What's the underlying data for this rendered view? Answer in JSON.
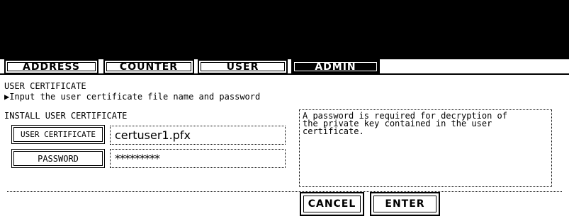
{
  "tabs": [
    {
      "label": "ADDRESS"
    },
    {
      "label": "COUNTER"
    },
    {
      "label": "USER"
    },
    {
      "label": "ADMIN"
    }
  ],
  "screen": {
    "title": "USER CERTIFICATE",
    "instruction": "▶Input the user certificate file name and password",
    "section_label": "INSTALL USER CERTIFICATE"
  },
  "form": {
    "cert_button_label": "USER CERTIFICATE",
    "cert_value": "certuser1.pfx",
    "password_button_label": "PASSWORD",
    "password_value": "*********"
  },
  "info_text": "A password is required for decryption of\nthe private key contained in the user\ncertificate.",
  "actions": {
    "cancel_label": "CANCEL",
    "enter_label": "ENTER"
  }
}
